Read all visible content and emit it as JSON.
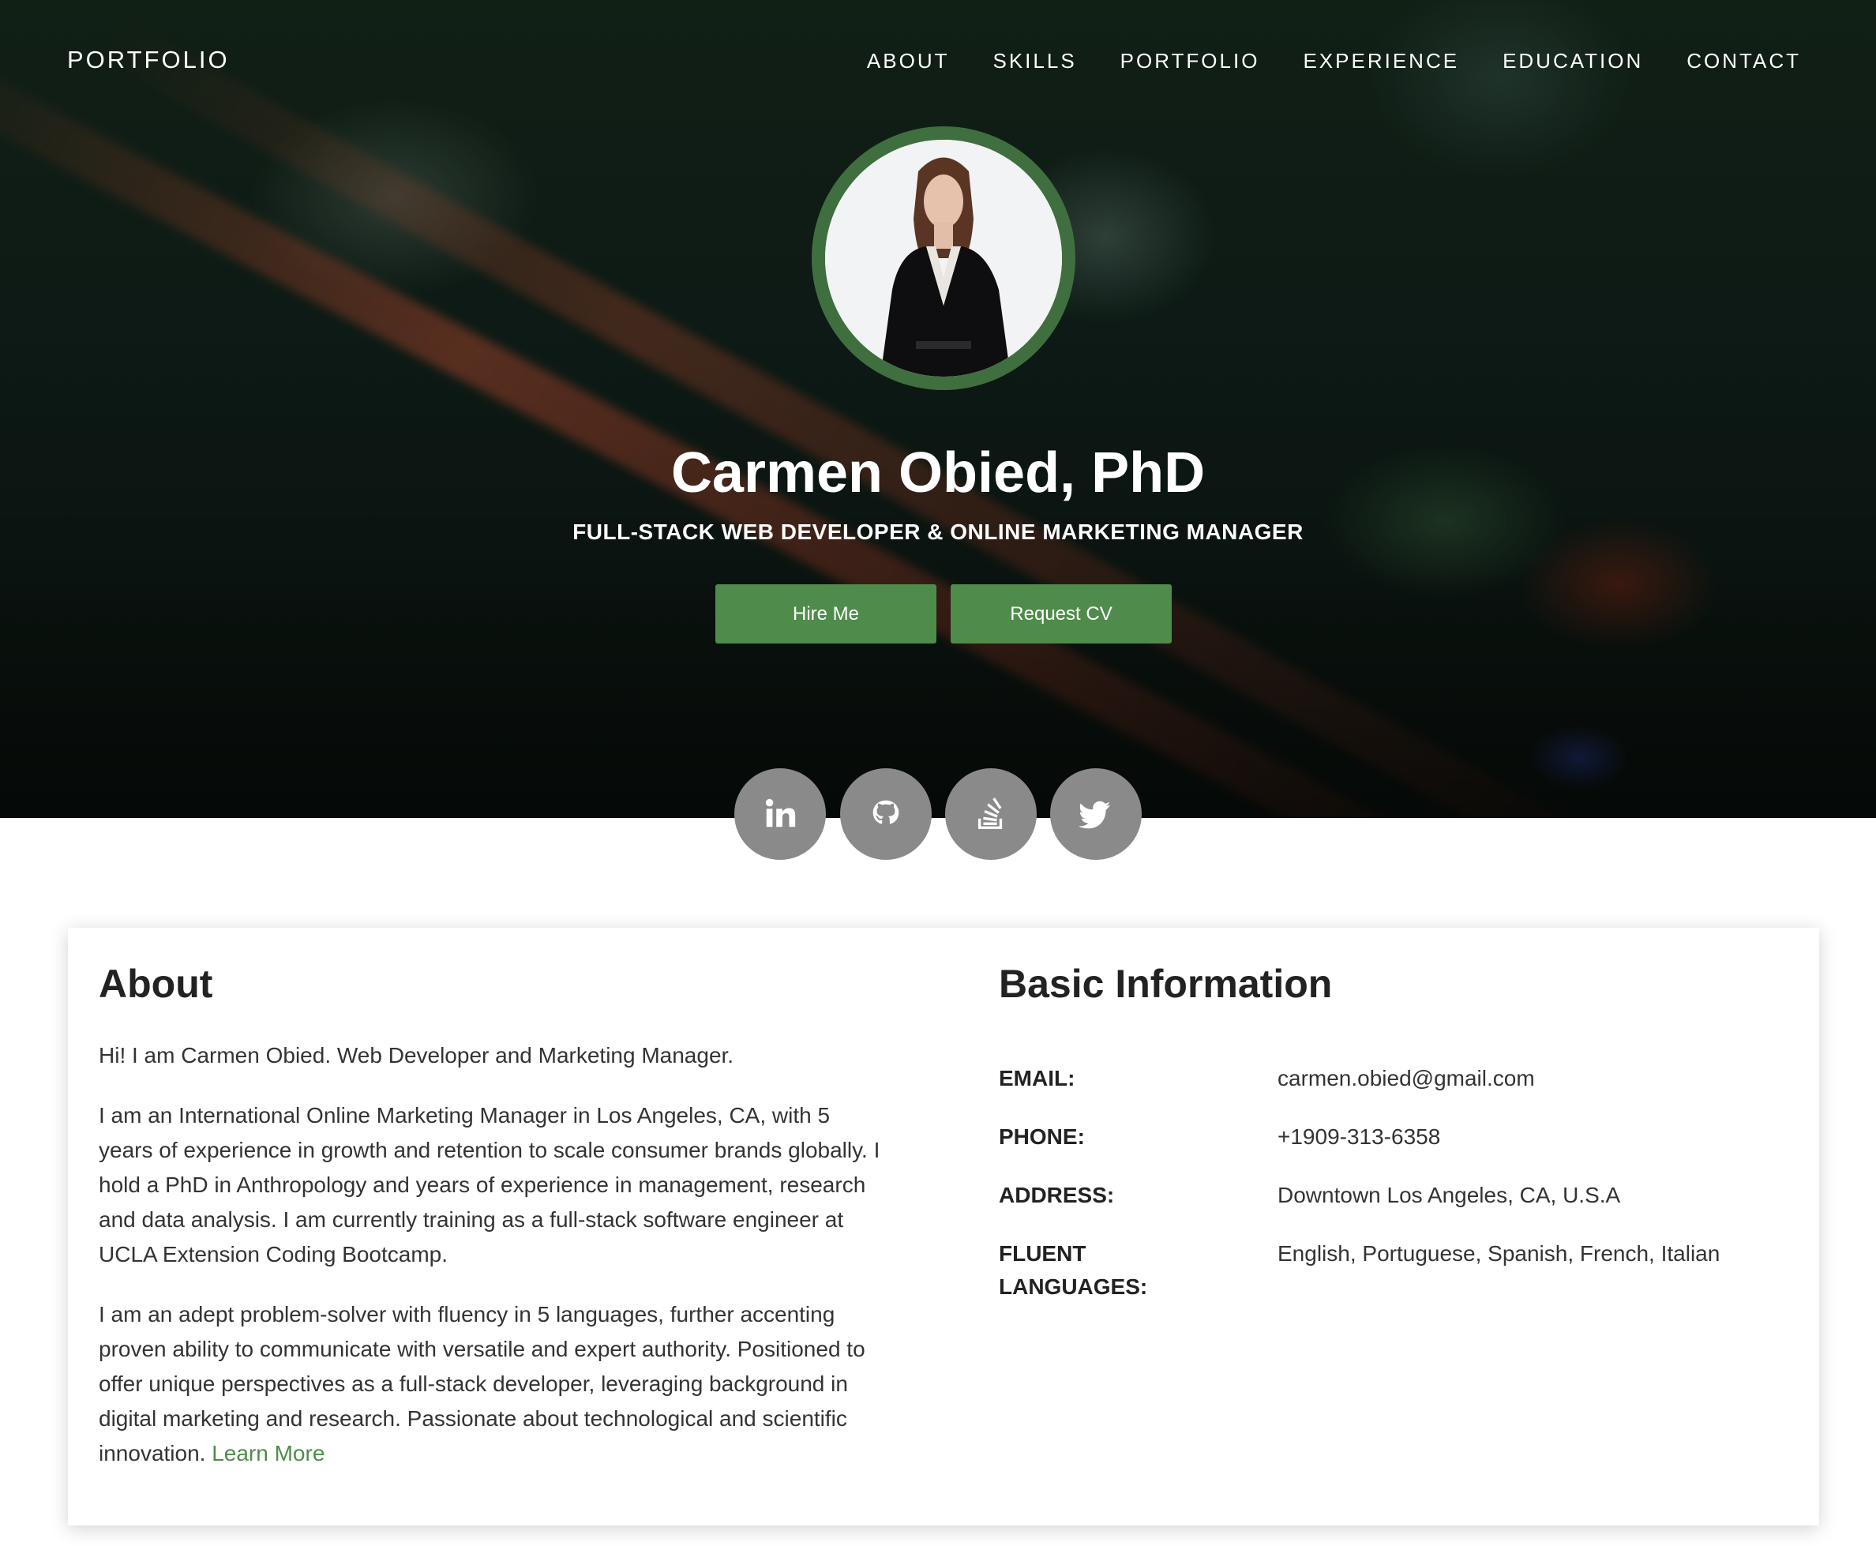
{
  "header": {
    "brand": "PORTFOLIO",
    "nav": [
      "ABOUT",
      "SKILLS",
      "PORTFOLIO",
      "EXPERIENCE",
      "EDUCATION",
      "CONTACT"
    ]
  },
  "hero": {
    "name": "Carmen Obied, PhD",
    "subtitle": "FULL-STACK WEB DEVELOPER & ONLINE MARKETING MANAGER",
    "buttons": {
      "hire": "Hire Me",
      "cv": "Request CV"
    }
  },
  "social": [
    "linkedin-icon",
    "github-icon",
    "stack-overflow-icon",
    "twitter-icon"
  ],
  "about": {
    "title": "About",
    "paragraphs": [
      "Hi! I am Carmen Obied. Web Developer and Marketing Manager.",
      "I am an International Online Marketing Manager in Los Angeles, CA, with 5 years of experience in growth and retention to scale consumer brands globally. I hold a PhD in Anthropology and years of experience in management, research and data analysis. I am currently training as a full-stack software engineer at UCLA Extension Coding Bootcamp.",
      "I am an adept problem-solver with fluency in 5 languages, further accenting proven ability to communicate with versatile and expert authority. Positioned to offer unique perspectives as a full-stack developer, leveraging background in digital marketing and research. Passionate about technological and scientific innovation."
    ],
    "learn_more": "Learn More"
  },
  "basic_info": {
    "title": "Basic Information",
    "rows": [
      {
        "label": "EMAIL:",
        "value": "carmen.obied@gmail.com"
      },
      {
        "label": "PHONE:",
        "value": "+1909-313-6358"
      },
      {
        "label": "ADDRESS:",
        "value": "Downtown Los Angeles, CA, U.S.A"
      },
      {
        "label": "FLUENT LANGUAGES:",
        "value": "English, Portuguese, Spanish, French, Italian"
      }
    ]
  },
  "colors": {
    "accent": "#4f8b4a",
    "avatar_ring": "#3f6f3e",
    "social_bg": "#8a8a8a"
  }
}
